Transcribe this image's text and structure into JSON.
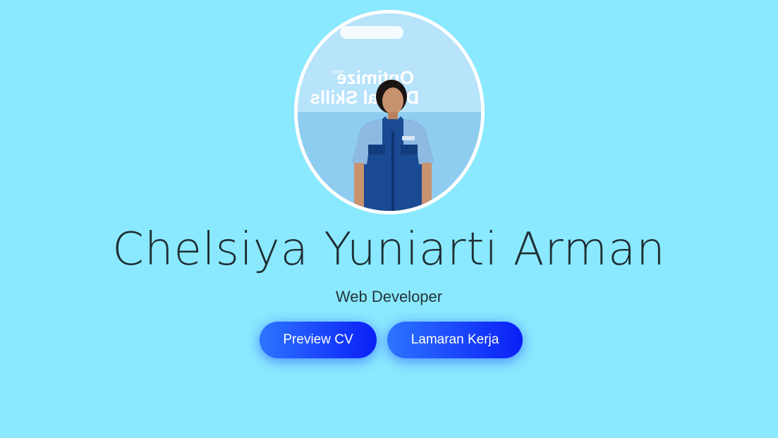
{
  "profile": {
    "name": "Chelsiya Yuniarti Arman",
    "role": "Web Developer",
    "photo_alt": "Profile photo"
  },
  "photo_backdrop": {
    "line1": "Optimize",
    "line2": "Digital Skills",
    "small": "Your"
  },
  "actions": {
    "preview_cv": "Preview CV",
    "job_application": "Lamaran Kerja"
  },
  "colors": {
    "background": "#8ae9fe",
    "button_start": "#2d74ff",
    "button_end": "#0a1ff7",
    "name_text": "#1f2d34"
  }
}
